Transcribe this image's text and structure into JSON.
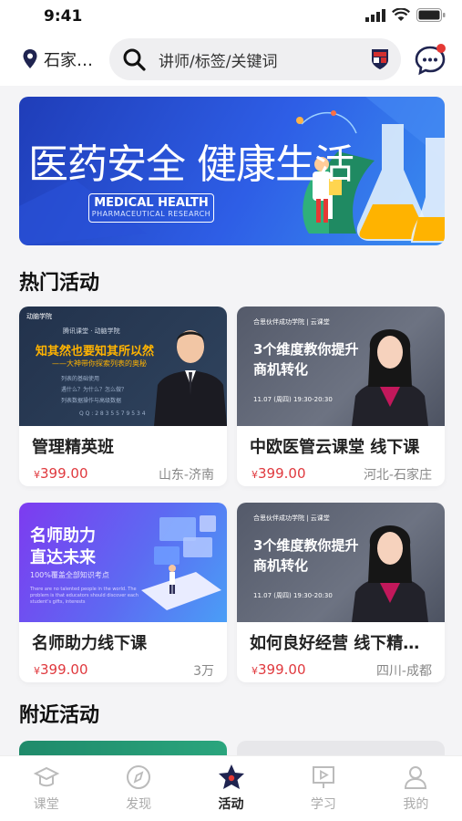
{
  "status": {
    "time": "9:41"
  },
  "top": {
    "location": "石家…",
    "search_placeholder": "讲师/标签/关键词"
  },
  "banner": {
    "title": "医药安全 健康生活",
    "en_title": "MEDICAL HEALTH",
    "en_sub": "PHARMACEUTICAL RESEARCH"
  },
  "sections": {
    "hot": "热门活动",
    "nearby": "附近活动"
  },
  "cards": [
    {
      "name": "管理精英班",
      "price": "399.00",
      "currency": "¥",
      "meta": "山东-济南",
      "img": {
        "brand": "动脑学院",
        "line0": "腾讯课堂 · 动脑学院",
        "line1": "知其然也要知其所以然",
        "line2": "——大神带你探索列表的奥秘",
        "items": [
          "列表的基础使用",
          "遇什么？为什么？怎么做？",
          "列表数据操作与高级数据"
        ],
        "badge": "Q Q : 2 8 3 5 5 7 9 5 3 4"
      }
    },
    {
      "name": "中欧医管云课堂 线下课",
      "price": "399.00",
      "currency": "¥",
      "meta": "河北-石家庄",
      "img": {
        "brand": "合思伙伴成功学院 | 云课堂",
        "line1": "3个维度教你提升",
        "line2": "商机转化",
        "date": "11.07 (周四) 19:30-20:30"
      }
    },
    {
      "name": "名师助力线下课",
      "price": "399.00",
      "currency": "¥",
      "meta": "3万",
      "img": {
        "line1": "名师助力",
        "line2": "直达未来",
        "line3": "100%覆盖全部知识考点",
        "line4": "There are no talented people in the world. The problem is that educators should discover each student's gifts, interests"
      }
    },
    {
      "name": "如何良好经营 线下精…",
      "price": "399.00",
      "currency": "¥",
      "meta": "四川-成都",
      "img": {
        "brand": "合思伙伴成功学院 | 云课堂",
        "line1": "3个维度教你提升",
        "line2": "商机转化",
        "date": "11.07 (周四) 19:30-20:30"
      }
    }
  ],
  "tabs": [
    {
      "label": "课堂",
      "icon": "graduation-cap-icon",
      "active": false
    },
    {
      "label": "发现",
      "icon": "compass-icon",
      "active": false
    },
    {
      "label": "活动",
      "icon": "star-icon",
      "active": true
    },
    {
      "label": "学习",
      "icon": "play-board-icon",
      "active": false
    },
    {
      "label": "我的",
      "icon": "user-icon",
      "active": false
    }
  ],
  "colors": {
    "price": "#e0393e",
    "accent_dark": "#1f2450",
    "message_dot": "#e53935"
  }
}
